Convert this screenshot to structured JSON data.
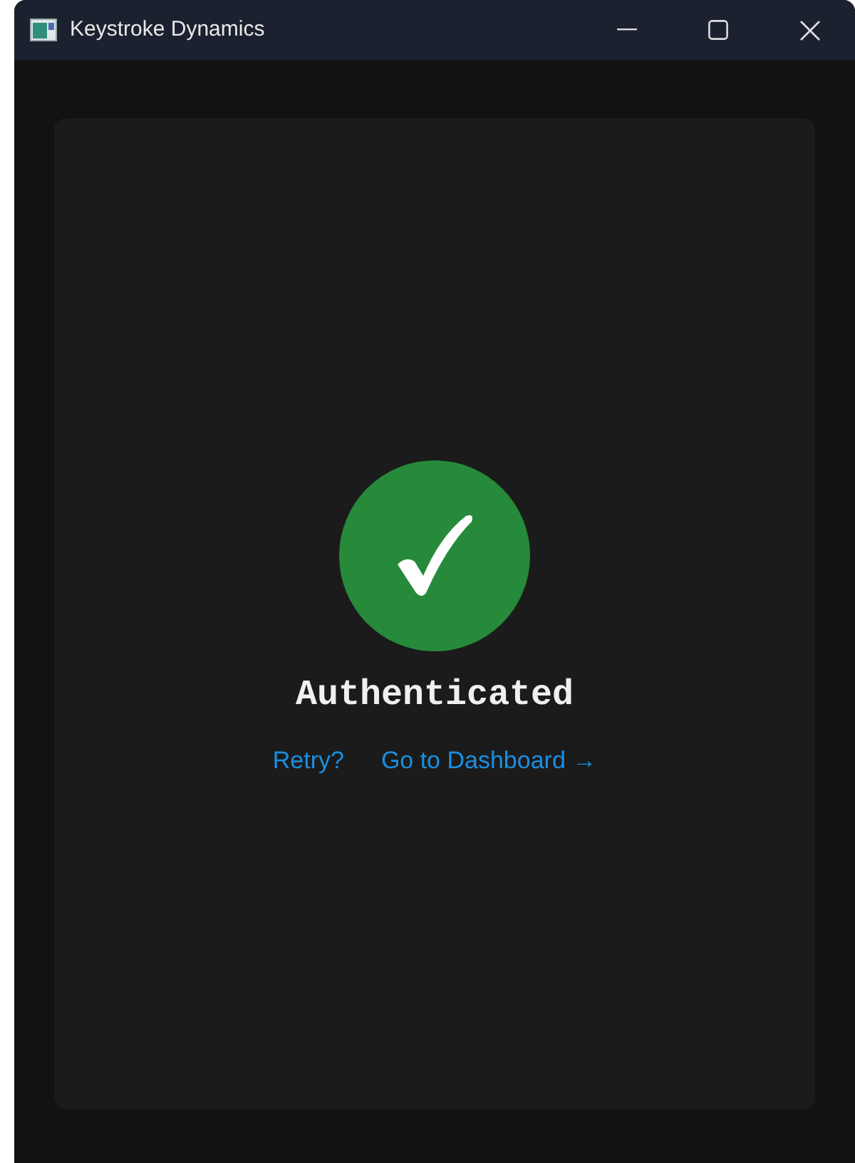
{
  "window": {
    "title": "Keystroke Dynamics"
  },
  "status": {
    "kind": "success",
    "label": "Authenticated"
  },
  "links": [
    {
      "label": "Retry?"
    },
    {
      "label": "Go to Dashboard →"
    }
  ]
}
